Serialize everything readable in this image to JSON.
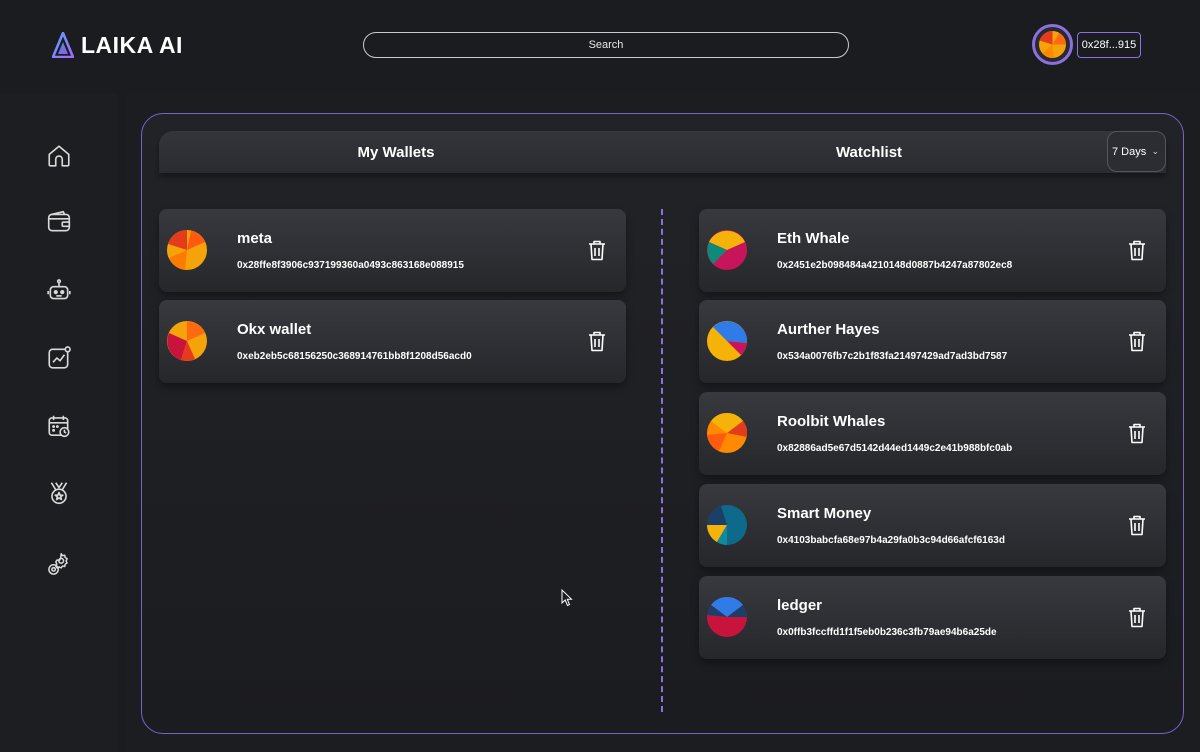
{
  "app": {
    "logo_text": "LAIKA AI"
  },
  "header": {
    "search_placeholder": "Search",
    "wallet_address_short": "0x28f...915"
  },
  "sidebar": {
    "items": [
      {
        "icon": "home-icon"
      },
      {
        "icon": "wallet-icon"
      },
      {
        "icon": "robot-icon"
      },
      {
        "icon": "chart-icon"
      },
      {
        "icon": "calendar-icon"
      },
      {
        "icon": "medal-icon"
      },
      {
        "icon": "settings-icon"
      }
    ]
  },
  "tabs": {
    "my_wallets": "My Wallets",
    "watchlist": "Watchlist",
    "period": "7 Days"
  },
  "my_wallets": [
    {
      "name": "meta",
      "address": "0x28ffe8f3906c937199360a0493c863168e088915"
    },
    {
      "name": "Okx wallet",
      "address": "0xeb2eb5c68156250c368914761bb8f1208d56acd0"
    }
  ],
  "watchlist": [
    {
      "name": "Eth Whale",
      "address": "0x2451e2b098484a4210148d0887b4247a87802ec8"
    },
    {
      "name": "Aurther Hayes",
      "address": "0x534a0076fb7c2b1f83fa21497429ad7ad3bd7587"
    },
    {
      "name": "Roolbit Whales",
      "address": "0x82886ad5e67d5142d44ed1449c2e41b988bfc0ab"
    },
    {
      "name": "Smart Money",
      "address": "0x4103babcfa68e97b4a29fa0b3c94d66afcf6163d"
    },
    {
      "name": "ledger",
      "address": "0x0ffb3fccffd1f1f5eb0b236c3fb79ae94b6a25de"
    }
  ],
  "colors": {
    "accent": "#8c6fe0",
    "background": "#1b1c20",
    "card": "#2f3035"
  }
}
